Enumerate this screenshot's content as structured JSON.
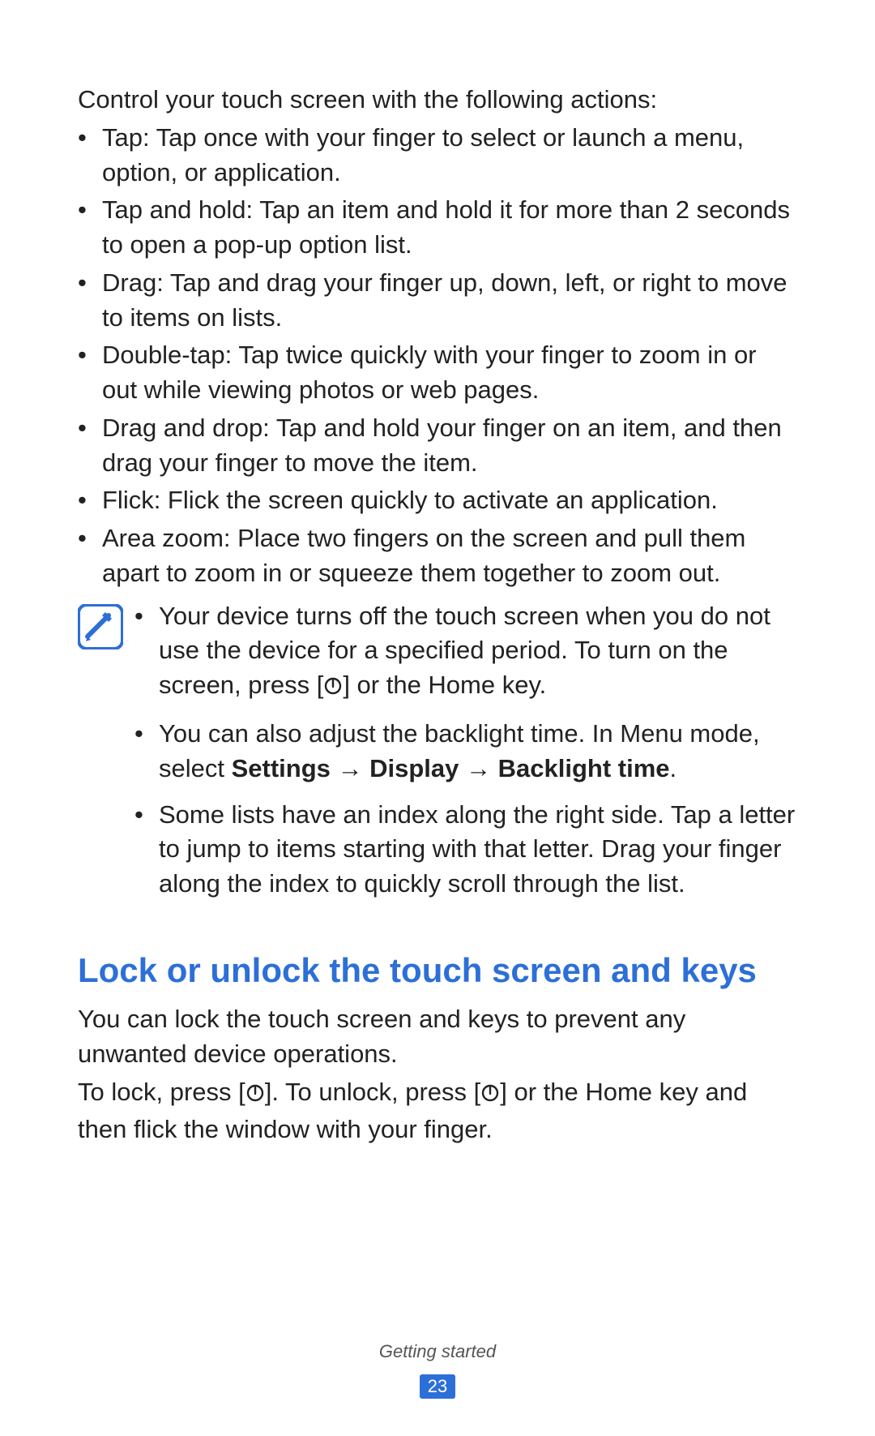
{
  "intro": "Control your touch screen with the following actions:",
  "actions": [
    "Tap: Tap once with your finger to select or launch a menu, option, or application.",
    "Tap and hold: Tap an item and hold it for more than 2 seconds to open a pop-up option list.",
    "Drag: Tap and drag your finger up, down, left, or right to move to items on lists.",
    "Double-tap: Tap twice quickly with your finger to zoom in or out while viewing photos or web pages.",
    "Drag and drop: Tap and hold your finger on an item, and then drag your finger to move the item.",
    "Flick: Flick the screen quickly to activate an application.",
    "Area zoom: Place two fingers on the screen and pull them apart to zoom in or squeeze them together to zoom out."
  ],
  "notes": {
    "item1_pre": "Your device turns off the touch screen when you do not use the device for a specified period. To turn on the screen, press [",
    "item1_post": "] or the Home key.",
    "item2_pre": "You can also adjust the backlight time. In Menu mode, select ",
    "item2_bold": "Settings → Display → Backlight time",
    "item2_post": ".",
    "item3": "Some lists have an index along the right side. Tap a letter to jump to items starting with that letter. Drag your finger along the index to quickly scroll through the list."
  },
  "heading": "Lock or unlock the touch screen and keys",
  "lock": {
    "p1": "You can lock the touch screen and keys to prevent any unwanted device operations.",
    "p2_a": "To lock, press [",
    "p2_b": "]. To unlock, press [",
    "p2_c": "] or the Home key and then flick the window with your finger."
  },
  "footer": {
    "section": "Getting started",
    "page": "23"
  }
}
